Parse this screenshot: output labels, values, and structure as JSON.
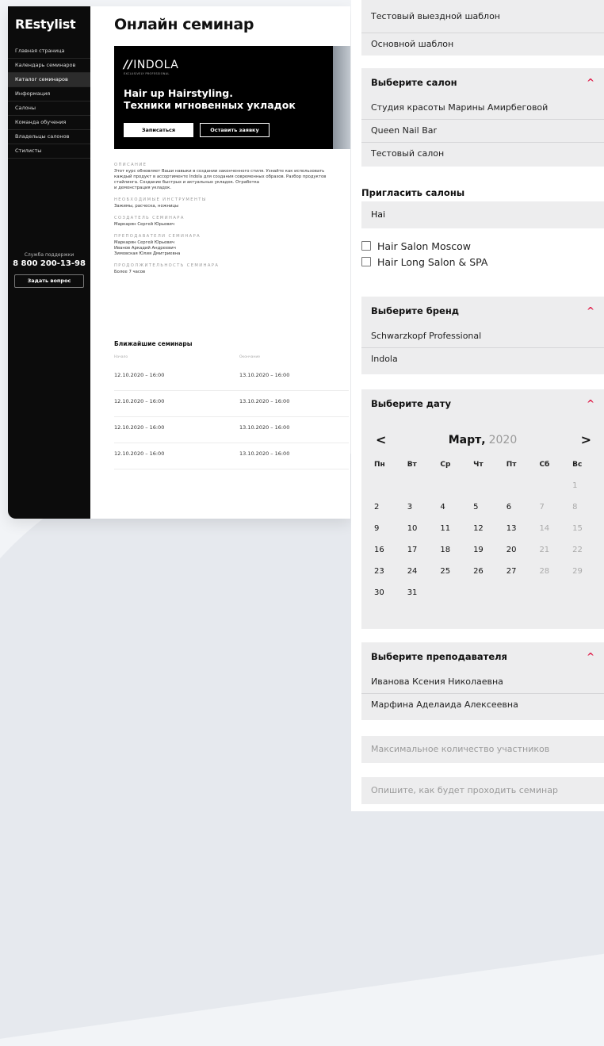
{
  "sidebar": {
    "logo": "REstylist",
    "items": [
      {
        "label": "Главная страница"
      },
      {
        "label": "Календарь семинаров"
      },
      {
        "label": "Каталог семинаров"
      },
      {
        "label": "Информация"
      },
      {
        "label": "Салоны"
      },
      {
        "label": "Команда обучения"
      },
      {
        "label": "Владельцы салонов"
      },
      {
        "label": "Стилисты"
      }
    ],
    "active_index": 2,
    "support_label": "Служба поддержки",
    "support_phone": "8 800 200-13-98",
    "ask_button": "Задать вопрос"
  },
  "main": {
    "title": "Онлайн семинар",
    "banner": {
      "brand_mark": "//",
      "brand_name": "INDOLA",
      "brand_sub": "EXCLUSIVELY PROFESSIONAL",
      "title_line1": "Hair up Hairstyling.",
      "title_line2": "Техники мгновенных укладок",
      "signup_button": "Записаться",
      "request_button": "Оставить заявку"
    },
    "info": [
      {
        "label": "ОПИСАНИЕ",
        "text": "Этот курс обновляет Ваши навыки в создании законченного стиля. Узнайте как использовать\nкаждый продукт в ассортименте Indola для создания современных образов. Разбор продуктов\nстайлинга. Создание быстрых и актуальных укладок. Отработка\nи демонстрация укладок."
      },
      {
        "label": "НЕОБХОДИМЫЕ ИНСТРУМЕНТЫ",
        "text": "Зажимы, расческа, ножницы"
      },
      {
        "label": "СОЗДАТЕЛЬ СЕМИНАРА",
        "text": "Маркарян Сергей Юрьевич"
      },
      {
        "label": "ПРЕПОДАВАТЕЛИ СЕМИНАРА",
        "text": "Маркарян Сергей Юрьевич\nИванов Аркадий Андреевич\nЗимовская Юлия Дмитриевна"
      },
      {
        "label": "ПРОДОЛЖИТЕЛЬНОСТЬ СЕМИНАРА",
        "text": "Более 7 часов"
      }
    ],
    "nearest": {
      "title": "Ближайшие семинары",
      "head_start": "Начало",
      "head_end": "Окончание",
      "rows": [
        {
          "start": "12.10.2020 – 16:00",
          "end": "13.10.2020 – 16:00"
        },
        {
          "start": "12.10.2020 – 16:00",
          "end": "13.10.2020 – 16:00"
        },
        {
          "start": "12.10.2020 – 16:00",
          "end": "13.10.2020 – 16:00"
        },
        {
          "start": "12.10.2020 – 16:00",
          "end": "13.10.2020 – 16:00"
        }
      ]
    }
  },
  "form": {
    "templates": [
      "Тестовый выездной шаблон",
      "Основной шаблон"
    ],
    "salon": {
      "header": "Выберите салон",
      "options": [
        "Студия красоты Марины Амирбеговой",
        "Queen Nail Bar",
        "Тестовый салон"
      ]
    },
    "invite": {
      "title": "Пригласить салоны",
      "value": "Hai",
      "results": [
        "Hair Salon Moscow",
        "Hair Long Salon & SPA"
      ]
    },
    "brand": {
      "header": "Выберите бренд",
      "options": [
        "Schwarzkopf Professional",
        "Indola"
      ]
    },
    "date": {
      "header": "Выберите дату",
      "prev": "<",
      "next": ">",
      "month": "Март,",
      "year": "2020",
      "weekdays": [
        "Пн",
        "Вт",
        "Ср",
        "Чт",
        "Пт",
        "Сб",
        "Вс"
      ],
      "weeks": [
        [
          "",
          "",
          "",
          "",
          "",
          "",
          "1"
        ],
        [
          "2",
          "3",
          "4",
          "5",
          "6",
          "7",
          "8"
        ],
        [
          "9",
          "10",
          "11",
          "12",
          "13",
          "14",
          "15"
        ],
        [
          "16",
          "17",
          "18",
          "19",
          "20",
          "21",
          "22"
        ],
        [
          "23",
          "24",
          "25",
          "26",
          "27",
          "28",
          "29"
        ],
        [
          "30",
          "31",
          "",
          "",
          "",
          "",
          ""
        ]
      ]
    },
    "teacher": {
      "header": "Выберите преподавателя",
      "options": [
        "Иванова Ксения Николаевна",
        "Марфина Аделаида Алексеевна"
      ]
    },
    "max_participants_placeholder": "Максимальное количество участников",
    "describe_placeholder": "Опишите, как будет проходить семинар",
    "accent_color": "#e0234e"
  }
}
